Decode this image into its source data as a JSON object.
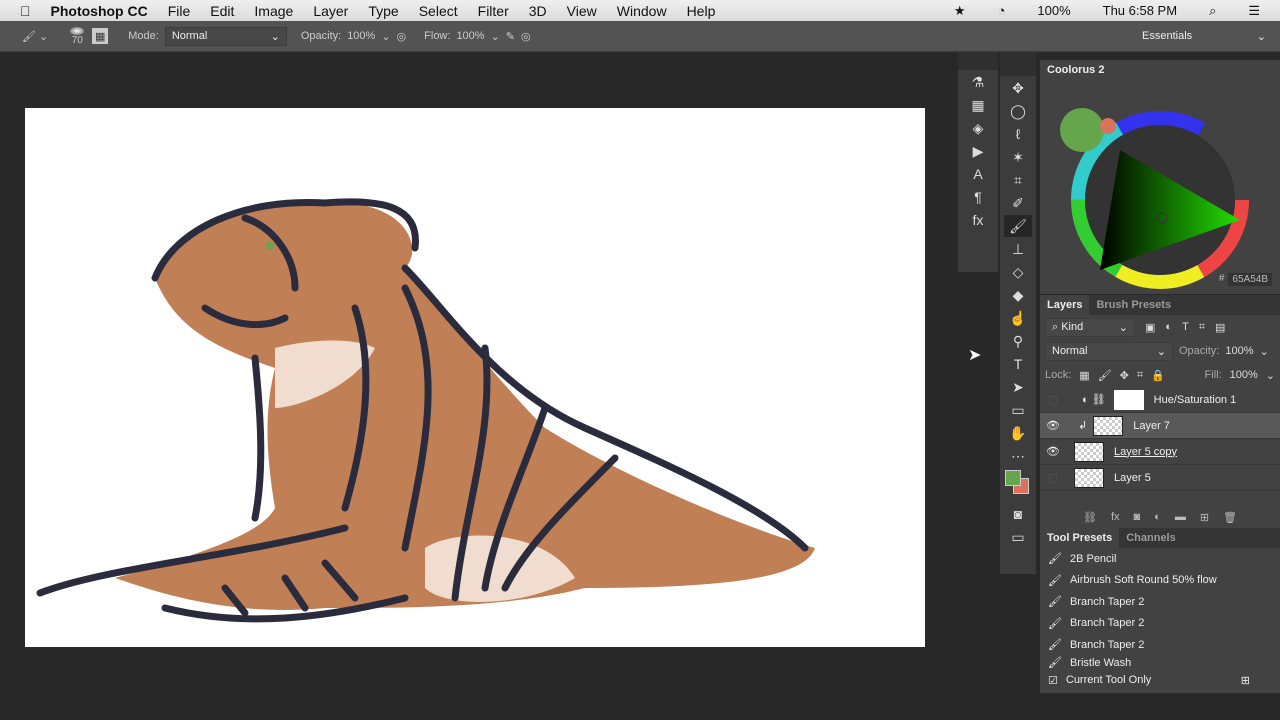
{
  "menubar": {
    "app": "Photoshop CC",
    "items": [
      "File",
      "Edit",
      "Image",
      "Layer",
      "Type",
      "Select",
      "Filter",
      "3D",
      "View",
      "Window",
      "Help"
    ],
    "battery": "100%",
    "clock": "Thu 6:58 PM"
  },
  "options": {
    "brush_size": "70",
    "mode_label": "Mode:",
    "mode": "Normal",
    "opacity_label": "Opacity:",
    "opacity": "100%",
    "flow_label": "Flow:",
    "flow": "100%",
    "workspace": "Essentials"
  },
  "colour_panel": {
    "title": "Coolorus 2",
    "hex_prefix": "#",
    "hex": "65A54B",
    "foreground": "#65a54b",
    "background": "#d9735e"
  },
  "layers": {
    "tabs": [
      "Layers",
      "Brush Presets"
    ],
    "filter": "Kind",
    "blend": "Normal",
    "opacity_label": "Opacity:",
    "opacity": "100%",
    "lock_label": "Lock:",
    "fill_label": "Fill:",
    "fill": "100%",
    "items": [
      {
        "name": "Hue/Saturation 1",
        "visible": false
      },
      {
        "name": "Layer 7",
        "visible": true,
        "selected": true
      },
      {
        "name": "Layer 5 copy",
        "visible": true
      },
      {
        "name": "Layer 5",
        "visible": false
      }
    ]
  },
  "presets": {
    "tabs": [
      "Tool Presets",
      "Channels"
    ],
    "items": [
      "2B Pencil",
      "Airbrush Soft Round 50% flow",
      "Branch Taper 2",
      "Branch Taper 2",
      "Branch Taper 2",
      "Bristle Wash"
    ],
    "current_only": "Current Tool Only"
  }
}
